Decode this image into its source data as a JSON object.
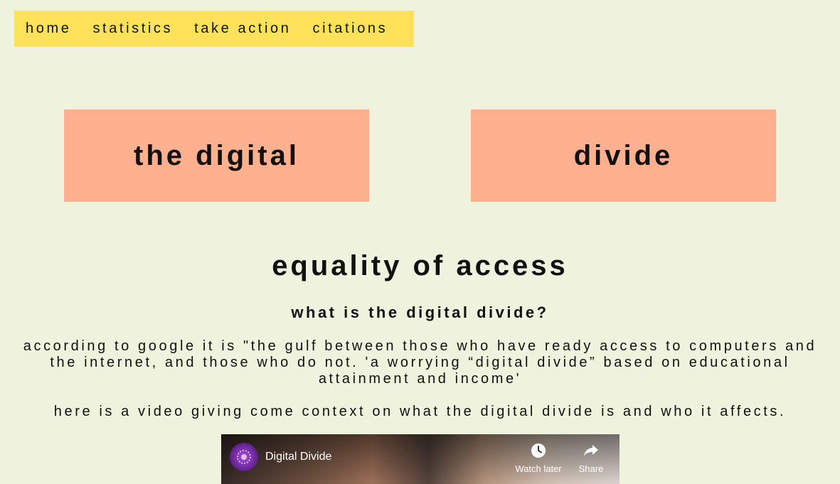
{
  "nav": {
    "items": [
      {
        "label": "home"
      },
      {
        "label": "statistics"
      },
      {
        "label": "take action"
      },
      {
        "label": "citations"
      }
    ]
  },
  "titles": {
    "left": "the digital",
    "right": "divide"
  },
  "content": {
    "heading": "equality of access",
    "subheading": "what is the digital divide?",
    "definition": "according to google it is \"the gulf between those who have ready access to computers and the internet, and those who do not. 'a worrying “digital divide” based on educational attainment and income'",
    "video_intro": "here is a video giving come context on what the digital divide is and who it affects."
  },
  "video": {
    "title": "Digital Divide",
    "watch_later_label": "Watch later",
    "share_label": "Share",
    "icons": {
      "channel": "channel-avatar-icon",
      "watch_later": "clock-icon",
      "share": "share-arrow-icon"
    }
  },
  "colors": {
    "background": "#eff2dc",
    "nav_bg": "#ffe259",
    "title_bg": "#ffb08e"
  }
}
